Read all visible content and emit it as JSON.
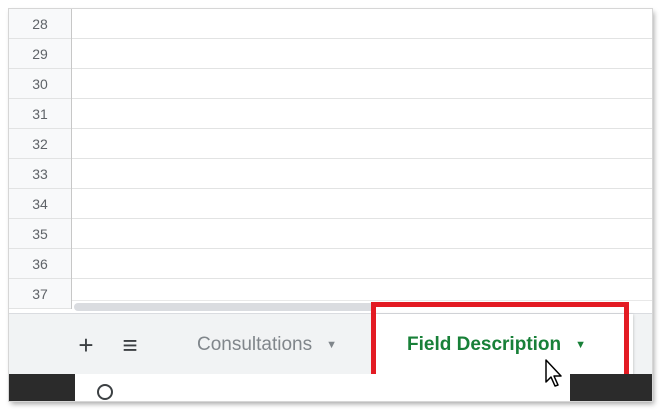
{
  "rows": [
    "28",
    "29",
    "30",
    "31",
    "32",
    "33",
    "34",
    "35",
    "36",
    "37"
  ],
  "tabbar": {
    "add_sheet_glyph": "+",
    "all_sheets_glyph": "≡",
    "tabs": [
      {
        "label": "Consultations",
        "active": false,
        "caret": "▼"
      },
      {
        "label": "Field Description",
        "active": true,
        "caret": "▼"
      }
    ]
  },
  "colors": {
    "active_tab_text": "#188038",
    "inactive_tab_text": "#80868b",
    "highlight_box": "#e31b23"
  },
  "icons": [
    "add-sheet-icon",
    "all-sheets-menu-icon",
    "dropdown-caret-icon",
    "mouse-pointer-icon",
    "search-icon"
  ]
}
